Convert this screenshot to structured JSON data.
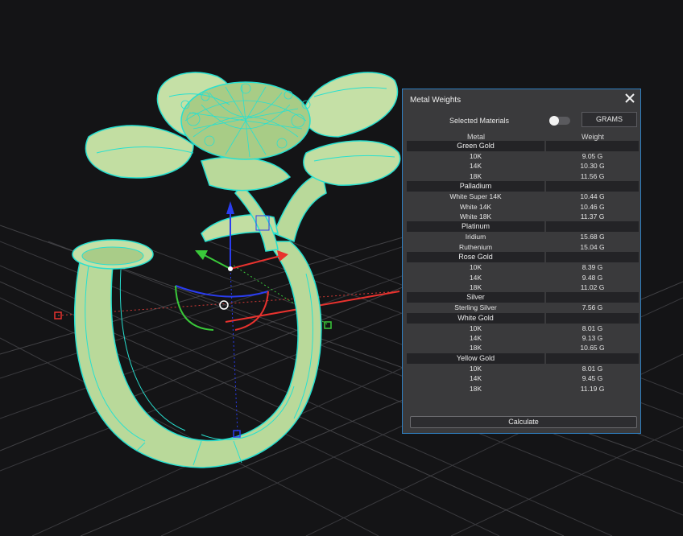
{
  "panel": {
    "title": "Metal Weights",
    "close_icon": "close-icon",
    "selected_materials_label": "Selected Materials",
    "selected_materials_on": false,
    "units_label": "GRAMS",
    "col_metal": "Metal",
    "col_weight": "Weight",
    "calculate_label": "Calculate"
  },
  "groups": [
    {
      "name": "Green Gold",
      "items": [
        {
          "metal": "10K",
          "weight": "9.05 G"
        },
        {
          "metal": "14K",
          "weight": "10.30 G"
        },
        {
          "metal": "18K",
          "weight": "11.56 G"
        }
      ]
    },
    {
      "name": "Palladium",
      "items": [
        {
          "metal": "White Super 14K",
          "weight": "10.44 G"
        },
        {
          "metal": "White 14K",
          "weight": "10.46 G"
        },
        {
          "metal": "White 18K",
          "weight": "11.37 G"
        }
      ]
    },
    {
      "name": "Platinum",
      "items": [
        {
          "metal": "Iridium",
          "weight": "15.68 G"
        },
        {
          "metal": "Ruthenium",
          "weight": "15.04 G"
        }
      ]
    },
    {
      "name": "Rose Gold",
      "items": [
        {
          "metal": "10K",
          "weight": "8.39 G"
        },
        {
          "metal": "14K",
          "weight": "9.48 G"
        },
        {
          "metal": "18K",
          "weight": "11.02 G"
        }
      ]
    },
    {
      "name": "Silver",
      "items": [
        {
          "metal": "Sterling Silver",
          "weight": "7.56 G"
        }
      ]
    },
    {
      "name": "White Gold",
      "items": [
        {
          "metal": "10K",
          "weight": "8.01 G"
        },
        {
          "metal": "14K",
          "weight": "9.13 G"
        },
        {
          "metal": "18K",
          "weight": "10.65 G"
        }
      ]
    },
    {
      "name": "Yellow Gold",
      "items": [
        {
          "metal": "10K",
          "weight": "8.01 G"
        },
        {
          "metal": "14K",
          "weight": "9.45 G"
        },
        {
          "metal": "18K",
          "weight": "11.19 G"
        }
      ]
    }
  ],
  "colors": {
    "background": "#141416",
    "model": "#b9d99a",
    "wireframe": "#27e0d0",
    "panel_border": "#2f7fc1",
    "axis_x": "#e8322e",
    "axis_y": "#3ac93a",
    "axis_z": "#2a3df0"
  }
}
